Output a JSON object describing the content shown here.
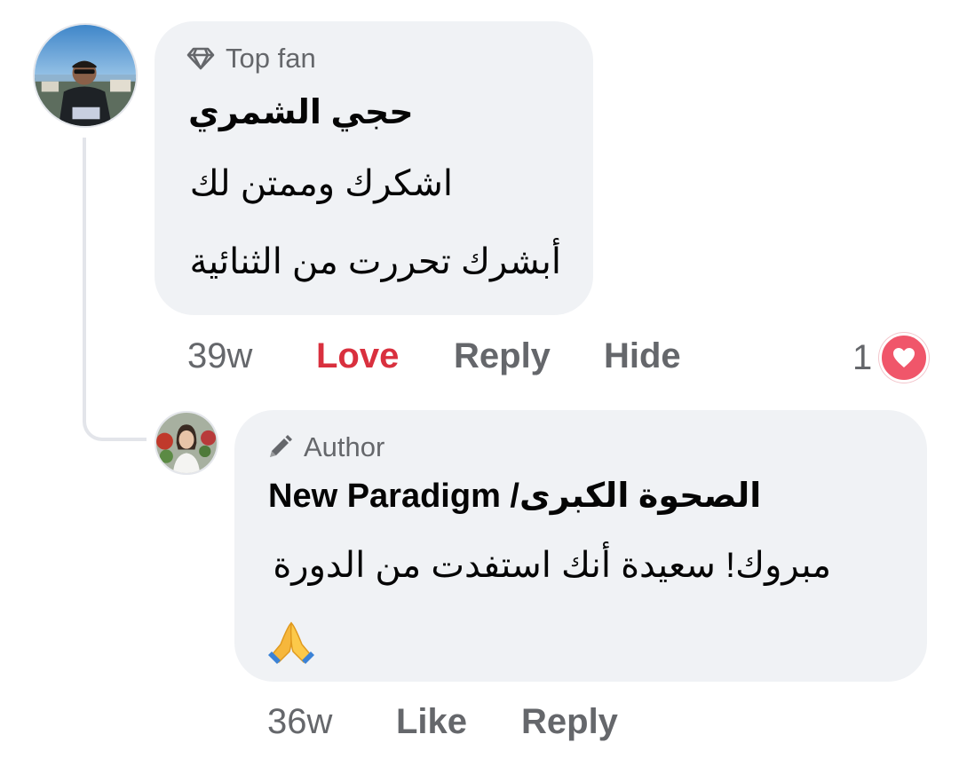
{
  "comments": [
    {
      "badge": "Top fan",
      "badge_icon": "diamond-icon",
      "author": "حجي الشمري",
      "lines": [
        "اشكرك وممتن لك",
        "أبشرك تحررت من الثنائية"
      ],
      "time": "39w",
      "actions": {
        "love": "Love",
        "reply": "Reply",
        "hide": "Hide"
      },
      "reaction_count": "1",
      "reaction_icon": "heart-icon"
    },
    {
      "badge": "Author",
      "badge_icon": "pencil-icon",
      "author": "New Paradigm /الصحوة الكبرى",
      "lines": [
        "مبروك! سعيدة أنك استفدت من الدورة"
      ],
      "emoji": "🙏",
      "time": "36w",
      "actions": {
        "like": "Like",
        "reply": "Reply"
      }
    }
  ],
  "colors": {
    "bubble": "#f0f2f5",
    "muted_text": "#65676b",
    "love": "#d9303e",
    "heart": "#f0566a"
  }
}
